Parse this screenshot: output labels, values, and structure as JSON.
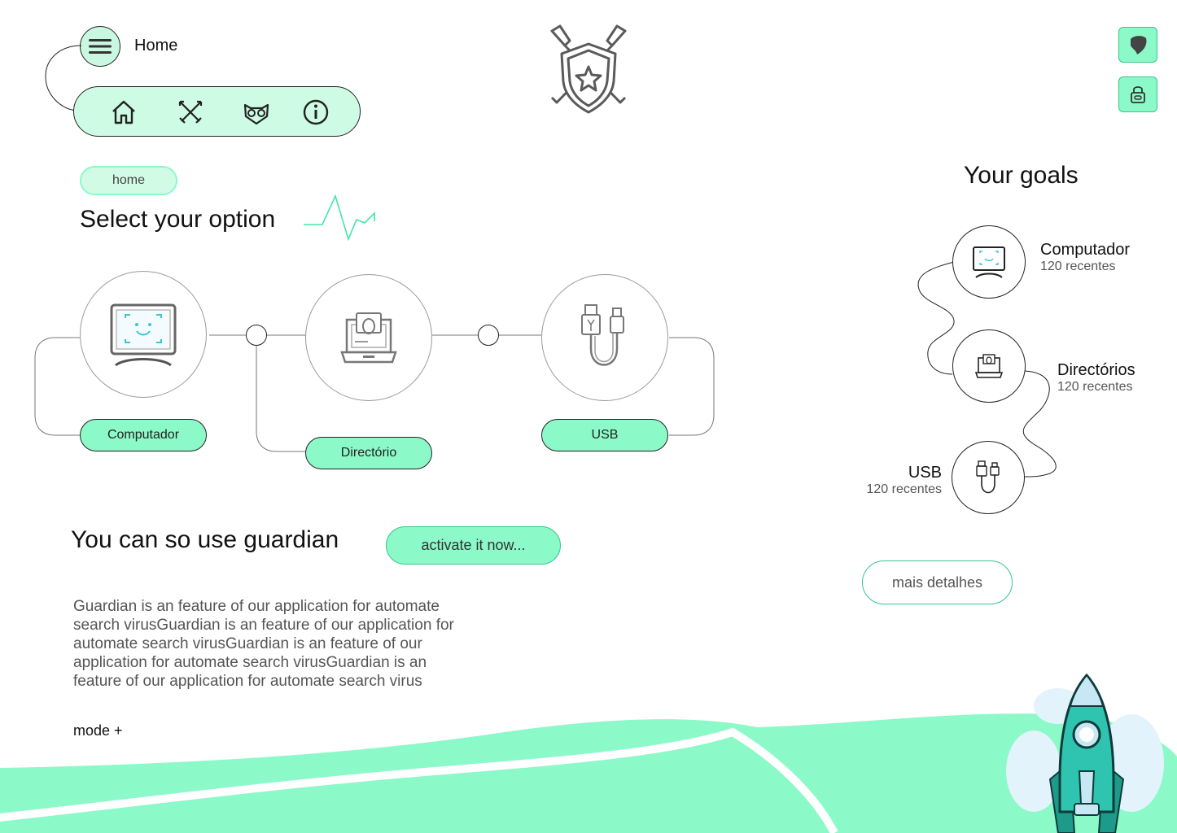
{
  "header": {
    "title": "Home",
    "nav_icons": [
      "home-icon",
      "swords-icon",
      "owl-icon",
      "info-icon"
    ]
  },
  "breadcrumb": "home",
  "main": {
    "title": "Select your option",
    "options": [
      {
        "label": "Computador",
        "icon": "monitor-icon"
      },
      {
        "label": "Directório",
        "icon": "laptop-icon"
      },
      {
        "label": "USB",
        "icon": "usb-icon"
      }
    ]
  },
  "guardian": {
    "title": "You can so use guardian",
    "activate_label": "activate it now...",
    "description": "Guardian is an feature of our application for automate search virusGuardian is an feature of our application for automate search virusGuardian is an feature of our application for automate search virusGuardian is an feature of our application for automate search virus",
    "more_label": "mode +"
  },
  "goals": {
    "title": "Your goals",
    "items": [
      {
        "name": "Computador",
        "count": "120 recentes"
      },
      {
        "name": "Directórios",
        "count": "120 recentes"
      },
      {
        "name": "USB",
        "count": "120 recentes"
      }
    ],
    "details_label": "mais detalhes"
  },
  "colors": {
    "accent": "#8cf9c8",
    "accent_light": "#cdfbe4",
    "accent_dark": "#38c48c",
    "teal": "#2fc4b0"
  }
}
